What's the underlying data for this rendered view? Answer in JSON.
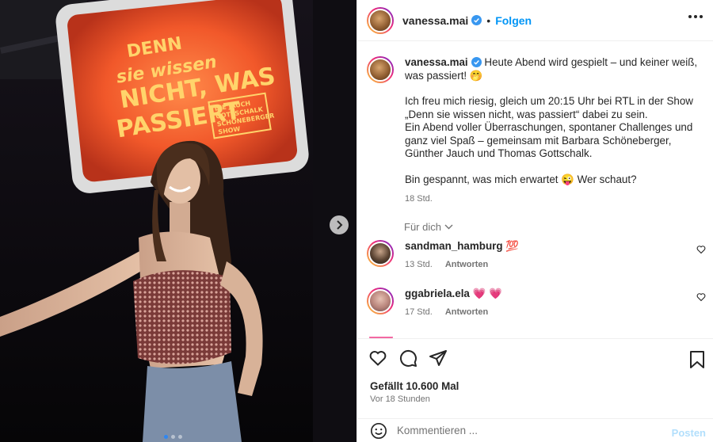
{
  "photo": {
    "sign_lines": [
      "DENN",
      "sie wissen",
      "NICHT, WAS",
      "PASSIERT"
    ],
    "sign_small": [
      "DIE JAUCH",
      "GOTTSCHALK",
      "SCHÖNEBERGER",
      "SHOW"
    ],
    "carousel_count": 3,
    "carousel_active": 1
  },
  "header": {
    "username": "vanessa.mai",
    "bullet": "•",
    "follow_label": "Folgen"
  },
  "caption": {
    "username": "vanessa.mai",
    "line1": "Heute Abend wird gespielt – und keiner weiß, was passiert! 🤭",
    "para2": "Ich freu mich riesig, gleich um 20:15 Uhr bei RTL in der Show „Denn sie wissen nicht, was passiert“ dabei zu sein.",
    "para3": "Ein Abend voller Überraschungen, spontaner Challenges und ganz viel Spaß – gemeinsam mit Barbara Schöneberger, Günther Jauch und Thomas Gottschalk.",
    "para4": "Bin gespannt, was mich erwartet 😜  Wer schaut?",
    "time": "18 Std."
  },
  "fuer_dich": "Für dich",
  "comments": [
    {
      "username": "sandman_hamburg",
      "text": "💯",
      "time": "13 Std.",
      "reply": "Antworten"
    },
    {
      "username": "ggabriela.ela",
      "text": "💗 💗",
      "time": "17 Std.",
      "reply": "Antworten"
    }
  ],
  "actions": {
    "likes": "Gefällt 10.600 Mal",
    "ago": "Vor 18 Stunden"
  },
  "comment_input": {
    "placeholder": "Kommentieren ...",
    "post_label": "Posten"
  },
  "colors": {
    "accent": "#0095f6",
    "verified": "#3897f0",
    "post_disabled": "#b2dffc",
    "sign_orange": "#ff6a33",
    "sign_text": "#ffd46b"
  }
}
